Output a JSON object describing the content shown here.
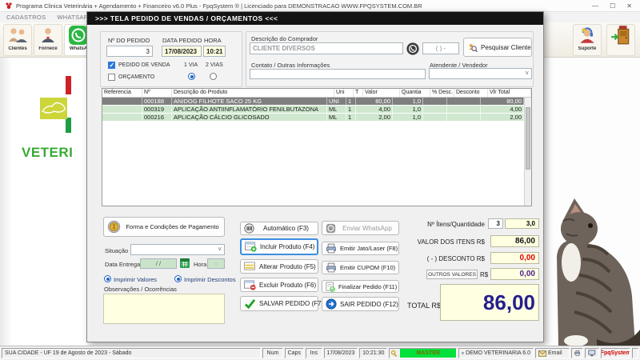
{
  "window": {
    "title": "Programa Clinica Veterinária + Agendamento + Financeiro v6.0 Plus - FpqSystem ® | Licenciado para  DEMONSTRACAO WWW.FPQSYSTEM.COM.BR",
    "minimize": "—",
    "maximize": "☐",
    "close": "✕"
  },
  "menubar": {
    "items": [
      "CADASTROS",
      "WHATSAPP"
    ]
  },
  "toolbar": {
    "left": [
      {
        "label": "Clientes"
      },
      {
        "label": "Fornece"
      },
      {
        "label": "WhatsA"
      }
    ],
    "right": [
      {
        "label": "Suporte"
      },
      {
        "label": ""
      }
    ]
  },
  "background": {
    "logo_text": "VETERI"
  },
  "dialog": {
    "title": ">>>   TELA PEDIDO DE VENDAS / ORÇAMENTOS   <<<",
    "order": {
      "numero_label": "Nº DO PEDIDO",
      "numero": "3",
      "data_label": "DATA PEDIDO",
      "data": "17/08/2023",
      "hora_label": "HORA",
      "hora": "10:21",
      "pedido_venda_label": "PEDIDO DE VENDA",
      "orcamento_label": "ORÇAMENTO",
      "via1_label": "1 VIA",
      "via2_label": "2 VIAS"
    },
    "comprador": {
      "label": "Descrição do Comprador",
      "value": "CLIENTE DIVERSOS",
      "phone_placeholder": "(  )      -",
      "pesquisar_label": "Pesquisar Cliente",
      "contato_label": "Contato / Outras Informações",
      "contato_value": "",
      "atendente_label": "Atendente / Vendedor",
      "atendente_value": ""
    },
    "table": {
      "headers": [
        "Referencia",
        "Nº",
        "Descrição do Produto",
        "Uni",
        "T",
        "Valor",
        "Quantia",
        "% Desc.",
        "Desconto",
        "Vlr Total"
      ],
      "rows": [
        {
          "referencia": "",
          "numero": "000188",
          "descricao": "ANIDOG FILHOTE  SACO 25 KG",
          "uni": "UNI",
          "t": "1",
          "valor": "80,00",
          "quantia": "1,0",
          "perc_desc": "",
          "desconto": "",
          "vlr_total": "80,00",
          "selected": true
        },
        {
          "referencia": "",
          "numero": "000319",
          "descricao": "APLICAÇÃO ANTIINFLAMATÓRIO FENILBUTAZONA",
          "uni": "ML",
          "t": "1",
          "valor": "4,00",
          "quantia": "1,0",
          "perc_desc": "",
          "desconto": "",
          "vlr_total": "4,00",
          "selected": false
        },
        {
          "referencia": "",
          "numero": "000216",
          "descricao": "APLICAÇÃO CÁLCIO GLICOSADO",
          "uni": "ML",
          "t": "1",
          "valor": "2,00",
          "quantia": "1,0",
          "perc_desc": "",
          "desconto": "",
          "vlr_total": "2,00",
          "selected": false
        }
      ]
    },
    "payment": {
      "forma_label": "Forma e Condições de Pagamento",
      "situacao_label": "Situação",
      "data_entrega_label": "Data Entrega",
      "data_entrega_value": "/  /",
      "hora_label": "Hora",
      "hora_value": ":",
      "imprimir_valores_label": "Imprimir Valores",
      "imprimir_descontos_label": "Imprimir Descontos",
      "observacoes_label": "Observações / Ocorrências"
    },
    "buttons": {
      "automatico": "Automático   (F3)",
      "incluir": "Incluir Produto  (F4)",
      "alterar": "Alterar Produto  (F5)",
      "excluir": "Excluir Produto  (F6)",
      "salvar": "SALVAR PEDIDO (F7)",
      "enviar_whatsapp": "Enviar WhatsApp",
      "emitir_jato": "Emitir Jato/Laser (F8)",
      "emitir_cupom": "Emitir CUPOM   (F10)",
      "finalizar": "Finalizar Pedido  (F11)",
      "sair": "SAIR  PEDIDO  (F12)"
    },
    "totals": {
      "itens_label": "Nº Ítens/Quantidade",
      "itens_count": "3",
      "itens_qty": "3,0",
      "valor_itens_label": "VALOR DOS ITENS R$",
      "valor_itens": "86,00",
      "desconto_label": "( - ) DESCONTO R$",
      "desconto": "0,00",
      "outros_label": "OUTROS VALORES",
      "outros_currency": "R$",
      "outros": "0,00",
      "total_label": "TOTAL R$",
      "total": "86,00"
    }
  },
  "statusbar": {
    "location": "SUA CIDADE - UF 19 de Agosto de 2023 - Sábado",
    "num": "Num",
    "caps": "Caps",
    "ins": "Ins",
    "date": "17/08/2023",
    "time": "10:21:30",
    "user": "MASTER",
    "company": "DEMO VETERINARIA 6.0",
    "email": "Email",
    "brand": "FpqSystem"
  },
  "colors": {
    "accent_blue": "#2b78d7",
    "selected_row": "#7f7f7f",
    "row_green": "#cfe8cf",
    "field_yellow": "#ffffe1",
    "total_navy": "#241f8c",
    "desconto_red": "#e00000",
    "outros_purple": "#4a1f8c",
    "master_green": "#00e13b",
    "brand_red": "#d00000",
    "whatsapp_green": "#2bb741"
  }
}
